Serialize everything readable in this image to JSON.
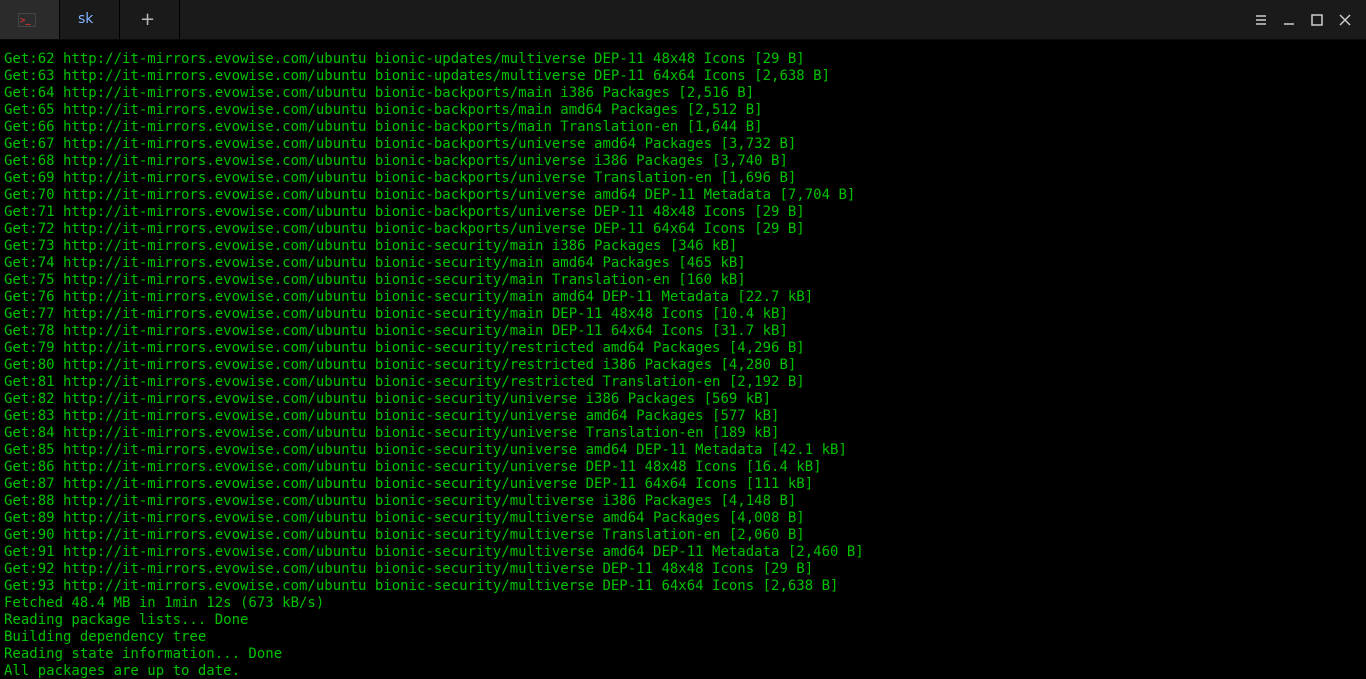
{
  "titlebar": {
    "tab_label": "sk",
    "new_tab_glyph": "+"
  },
  "mirror": "http://it-mirrors.evowise.com/ubuntu",
  "lines": [
    {
      "n": 62,
      "path": "bionic-updates/multiverse DEP-11 48x48 Icons",
      "size": "29 B"
    },
    {
      "n": 63,
      "path": "bionic-updates/multiverse DEP-11 64x64 Icons",
      "size": "2,638 B"
    },
    {
      "n": 64,
      "path": "bionic-backports/main i386 Packages",
      "size": "2,516 B"
    },
    {
      "n": 65,
      "path": "bionic-backports/main amd64 Packages",
      "size": "2,512 B"
    },
    {
      "n": 66,
      "path": "bionic-backports/main Translation-en",
      "size": "1,644 B"
    },
    {
      "n": 67,
      "path": "bionic-backports/universe amd64 Packages",
      "size": "3,732 B"
    },
    {
      "n": 68,
      "path": "bionic-backports/universe i386 Packages",
      "size": "3,740 B"
    },
    {
      "n": 69,
      "path": "bionic-backports/universe Translation-en",
      "size": "1,696 B"
    },
    {
      "n": 70,
      "path": "bionic-backports/universe amd64 DEP-11 Metadata",
      "size": "7,704 B"
    },
    {
      "n": 71,
      "path": "bionic-backports/universe DEP-11 48x48 Icons",
      "size": "29 B"
    },
    {
      "n": 72,
      "path": "bionic-backports/universe DEP-11 64x64 Icons",
      "size": "29 B"
    },
    {
      "n": 73,
      "path": "bionic-security/main i386 Packages",
      "size": "346 kB"
    },
    {
      "n": 74,
      "path": "bionic-security/main amd64 Packages",
      "size": "465 kB"
    },
    {
      "n": 75,
      "path": "bionic-security/main Translation-en",
      "size": "160 kB"
    },
    {
      "n": 76,
      "path": "bionic-security/main amd64 DEP-11 Metadata",
      "size": "22.7 kB"
    },
    {
      "n": 77,
      "path": "bionic-security/main DEP-11 48x48 Icons",
      "size": "10.4 kB"
    },
    {
      "n": 78,
      "path": "bionic-security/main DEP-11 64x64 Icons",
      "size": "31.7 kB"
    },
    {
      "n": 79,
      "path": "bionic-security/restricted amd64 Packages",
      "size": "4,296 B"
    },
    {
      "n": 80,
      "path": "bionic-security/restricted i386 Packages",
      "size": "4,280 B"
    },
    {
      "n": 81,
      "path": "bionic-security/restricted Translation-en",
      "size": "2,192 B"
    },
    {
      "n": 82,
      "path": "bionic-security/universe i386 Packages",
      "size": "569 kB"
    },
    {
      "n": 83,
      "path": "bionic-security/universe amd64 Packages",
      "size": "577 kB"
    },
    {
      "n": 84,
      "path": "bionic-security/universe Translation-en",
      "size": "189 kB"
    },
    {
      "n": 85,
      "path": "bionic-security/universe amd64 DEP-11 Metadata",
      "size": "42.1 kB"
    },
    {
      "n": 86,
      "path": "bionic-security/universe DEP-11 48x48 Icons",
      "size": "16.4 kB"
    },
    {
      "n": 87,
      "path": "bionic-security/universe DEP-11 64x64 Icons",
      "size": "111 kB"
    },
    {
      "n": 88,
      "path": "bionic-security/multiverse i386 Packages",
      "size": "4,148 B"
    },
    {
      "n": 89,
      "path": "bionic-security/multiverse amd64 Packages",
      "size": "4,008 B"
    },
    {
      "n": 90,
      "path": "bionic-security/multiverse Translation-en",
      "size": "2,060 B"
    },
    {
      "n": 91,
      "path": "bionic-security/multiverse amd64 DEP-11 Metadata",
      "size": "2,460 B"
    },
    {
      "n": 92,
      "path": "bionic-security/multiverse DEP-11 48x48 Icons",
      "size": "29 B"
    },
    {
      "n": 93,
      "path": "bionic-security/multiverse DEP-11 64x64 Icons",
      "size": "2,638 B"
    }
  ],
  "summary": [
    "Fetched 48.4 MB in 1min 12s (673 kB/s)",
    "Reading package lists... Done",
    "Building dependency tree",
    "Reading state information... Done",
    "All packages are up to date."
  ]
}
